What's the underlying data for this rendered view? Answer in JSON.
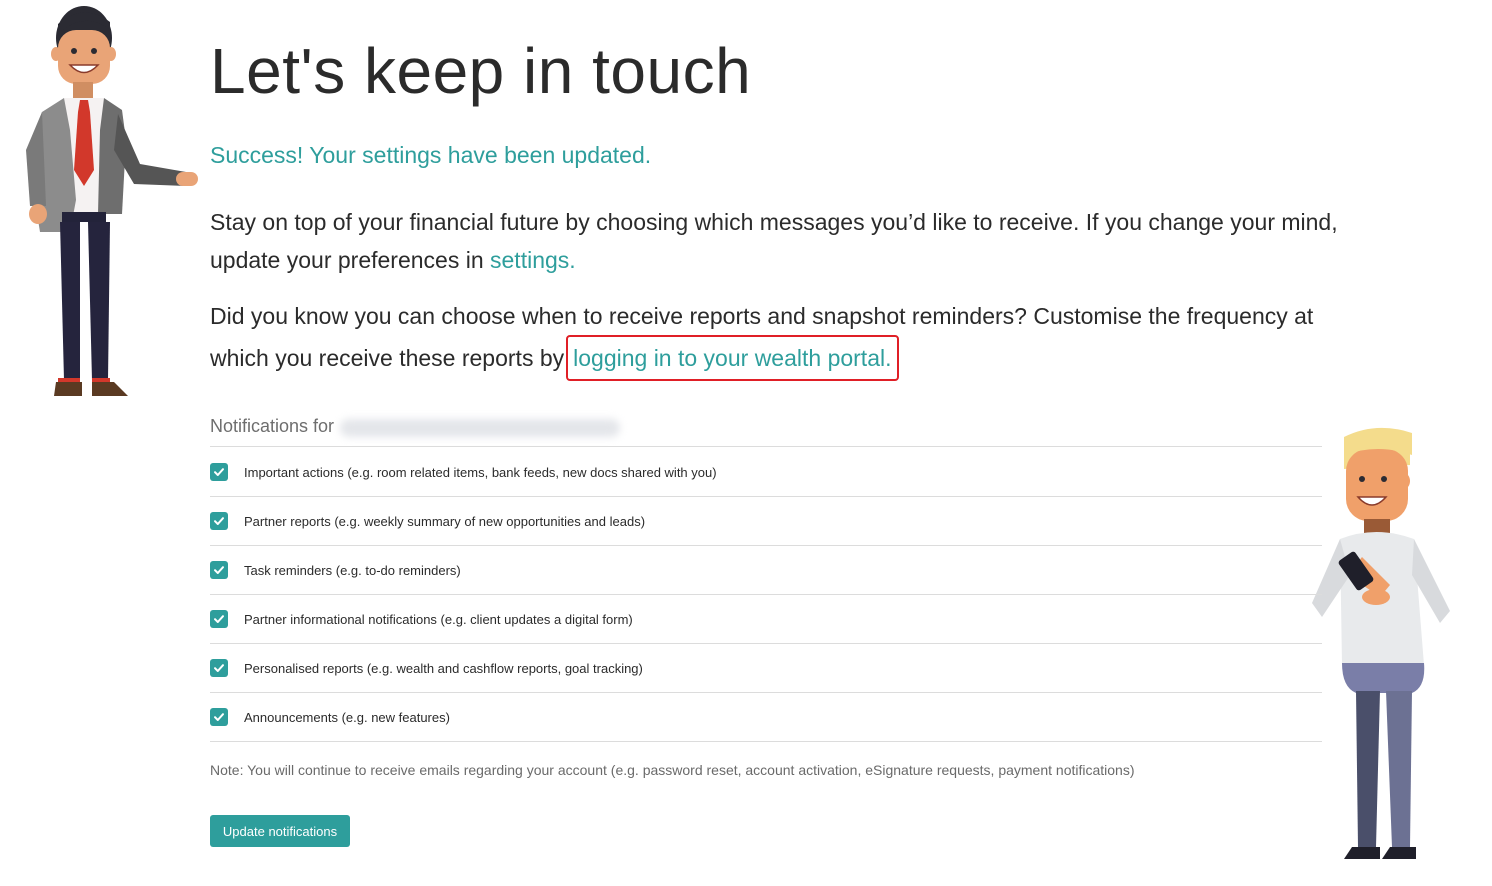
{
  "header": {
    "title": "Let's keep in touch",
    "success_message": "Success! Your settings have been updated."
  },
  "intro": {
    "text_before_link": "Stay on top of your financial future by choosing which messages you’d like to receive. If you change your mind, update your preferences in ",
    "settings_link": "settings."
  },
  "reports_info": {
    "text_before_link": "Did you know you can choose when to receive reports and snapshot reminders? Customise the frequency at which you receive these reports by",
    "portal_link": "logging in to your wealth portal."
  },
  "notifications": {
    "header_label": "Notifications for",
    "items": [
      {
        "label": "Important actions (e.g. room related items, bank feeds, new docs shared with you)",
        "checked": true
      },
      {
        "label": "Partner reports (e.g. weekly summary of new opportunities and leads)",
        "checked": true
      },
      {
        "label": "Task reminders (e.g. to-do reminders)",
        "checked": true
      },
      {
        "label": "Partner informational notifications (e.g. client updates a digital form)",
        "checked": true
      },
      {
        "label": "Personalised reports (e.g. wealth and cashflow reports, goal tracking)",
        "checked": true
      },
      {
        "label": "Announcements (e.g. new features)",
        "checked": true
      }
    ],
    "note": "Note: You will continue to receive emails regarding your account (e.g. password reset, account activation, eSignature requests, payment notifications)",
    "button_label": "Update notifications"
  },
  "colors": {
    "accent": "#2e9e9c",
    "highlight_border": "#e01f26",
    "text": "#2b2b2b",
    "muted": "#6e6e6e"
  },
  "icons": {
    "checkbox": "checkmark-icon",
    "left_illustration": "businessman-illustration",
    "right_illustration": "man-with-phone-illustration"
  }
}
